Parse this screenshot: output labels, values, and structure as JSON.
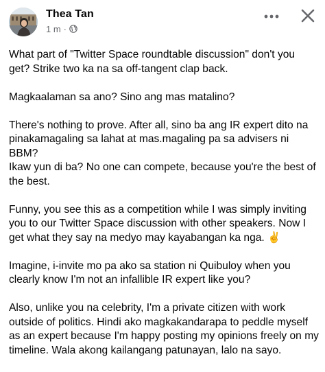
{
  "post": {
    "author": "Thea Tan",
    "time": "1 m",
    "separator": "·",
    "privacy_icon": "globe-icon",
    "more_icon": "more-options-icon",
    "close_icon": "close-icon",
    "paragraphs": [
      "What part of \"Twitter Space roundtable discussion\" don't you\nget? Strike two ka na sa off-tangent clap back.",
      "Magkaalaman sa ano? Sino ang mas matalino?",
      "There's nothing to prove. After all, sino ba ang IR expert dito na\npinakamagaling sa lahat at mas.magaling pa sa advisers ni BBM?\nIkaw yun di ba? No one can compete, because you're the best of\nthe best.",
      "Funny, you see this as a competition while I was simply inviting\nyou to our Twitter Space discussion with other speakers. Now I\nget what they say na medyo may kayabangan ka nga. ✌️",
      "Imagine, i-invite mo pa ako sa station ni Quibuloy when you\nclearly know I'm not an infallible IR expert like you?",
      "Also, unlike you na celebrity, I'm a private citizen with work\noutside of politics. Hindi ako magkakandarapa to peddle myself\nas an expert because I'm happy posting my opinions freely on my\ntimeline. Wala akong kailangang patunayan, lalo na sayo."
    ]
  }
}
